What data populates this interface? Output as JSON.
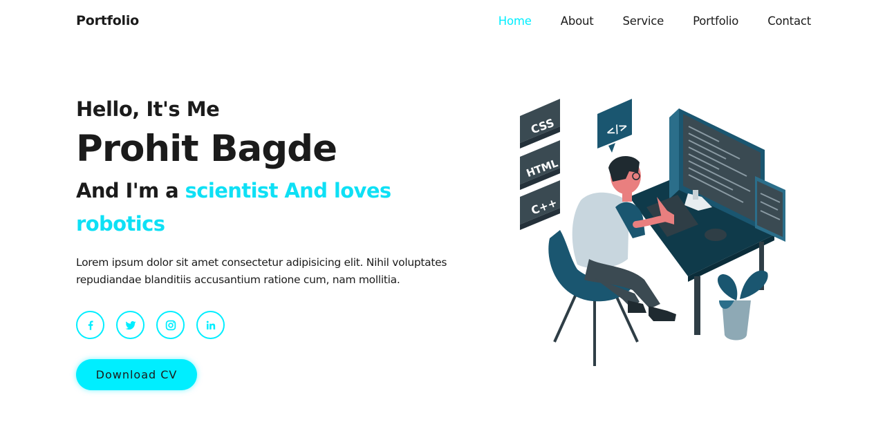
{
  "header": {
    "logo": "Portfolio",
    "nav": [
      {
        "label": "Home",
        "active": true
      },
      {
        "label": "About",
        "active": false
      },
      {
        "label": "Service",
        "active": false
      },
      {
        "label": "Portfolio",
        "active": false
      },
      {
        "label": "Contact",
        "active": false
      }
    ]
  },
  "home": {
    "greeting": "Hello, It's Me",
    "name": "Prohit Bagde",
    "role_prefix": "And I'm a",
    "role_highlight": "scientist And loves robotics",
    "description": "Lorem ipsum dolor sit amet consectetur adipisicing elit. Nihil voluptates repudiandae blanditiis accusantium ratione cum, nam mollitia.",
    "socials": [
      {
        "icon": "facebook-icon"
      },
      {
        "icon": "twitter-icon"
      },
      {
        "icon": "instagram-icon"
      },
      {
        "icon": "linkedin-icon"
      }
    ],
    "cta_label": "Download CV"
  },
  "illustration": {
    "badges": [
      "CSS",
      "HTML",
      "C++",
      "</>"
    ]
  },
  "colors": {
    "accent": "#00eeff",
    "text": "#1b1b1b",
    "background": "#ffffff",
    "illustration_dark": "#1a5670"
  }
}
